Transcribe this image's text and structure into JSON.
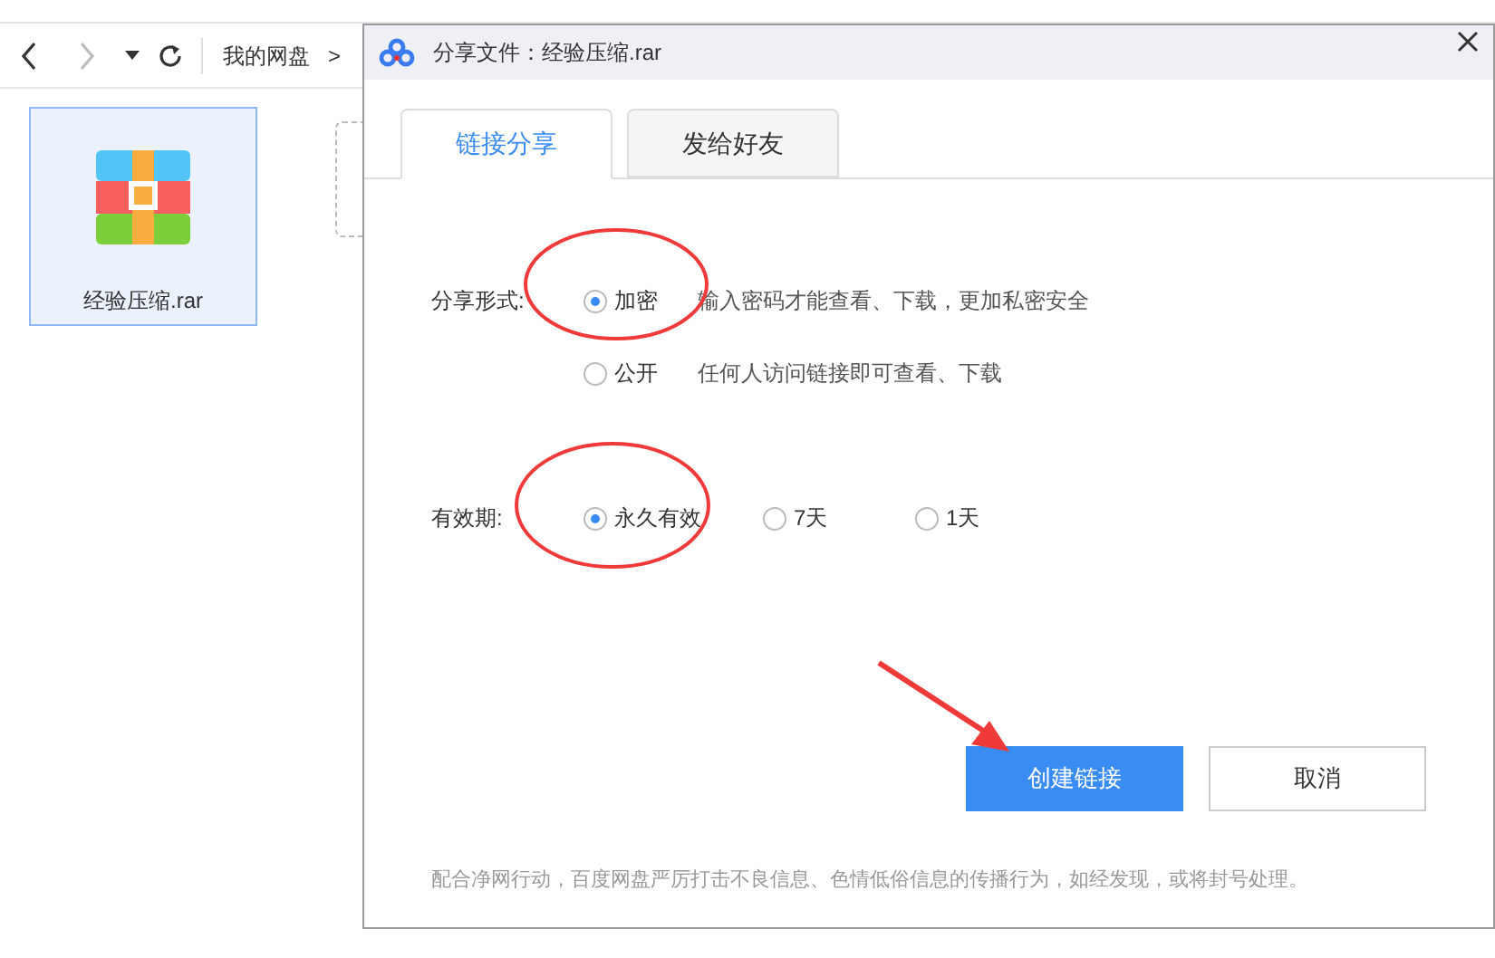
{
  "file_browser": {
    "breadcrumb": "我的网盘",
    "breadcrumb_separator": ">",
    "files": [
      {
        "name": "经验压缩.rar",
        "kind": "archive",
        "selected": true
      }
    ]
  },
  "dialog": {
    "title": "分享文件：经验压缩.rar",
    "tabs": [
      {
        "label": "链接分享",
        "selected": true
      },
      {
        "label": "发给好友",
        "selected": false
      }
    ],
    "share_form": {
      "label": "分享形式:",
      "options": [
        {
          "label": "加密",
          "description": "输入密码才能查看、下载，更加私密安全",
          "selected": true
        },
        {
          "label": "公开",
          "description": "任何人访问链接即可查看、下载",
          "selected": false
        }
      ]
    },
    "validity": {
      "label": "有效期:",
      "options": [
        {
          "label": "永久有效",
          "selected": true
        },
        {
          "label": "7天",
          "selected": false
        },
        {
          "label": "1天",
          "selected": false
        }
      ]
    },
    "buttons": [
      {
        "label": "创建链接",
        "kind": "primary"
      },
      {
        "label": "取消",
        "kind": "secondary"
      }
    ],
    "notice": "配合净网行动，百度网盘严厉打击不良信息、色情低俗信息的传播行为，如经发现，或将封号处理。"
  }
}
